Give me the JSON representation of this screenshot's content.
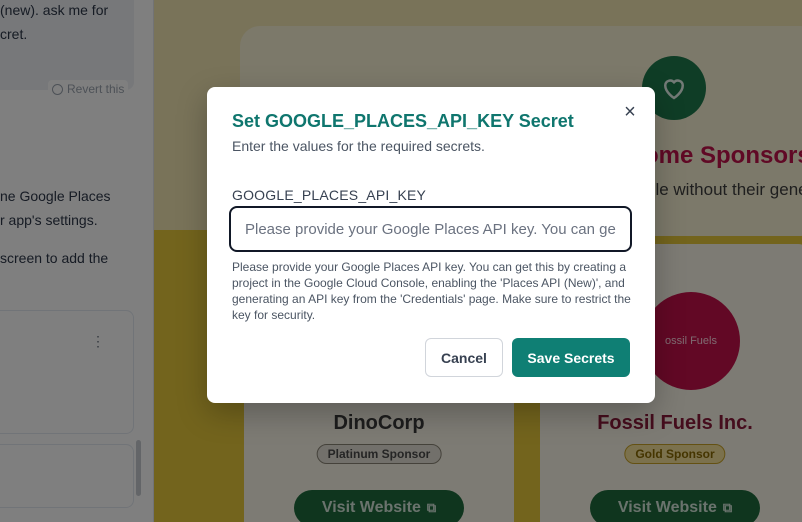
{
  "chat": {
    "bubble_lines": [
      "(new). ask me for",
      "cret."
    ],
    "revert_label": "Revert this",
    "message_lines": [
      "ne Google Places",
      "r app's settings.",
      "screen to add the"
    ]
  },
  "preview": {
    "section_title": "ome Sponsors",
    "section_subtitle": "ble without their gene",
    "sponsors": [
      {
        "name": "DinoCorp",
        "tier": "Platinum Sponsor",
        "logo_text": "",
        "button": "Visit Website"
      },
      {
        "name": "Fossil Fuels Inc.",
        "tier": "Gold Sponsor",
        "logo_text": "ossil Fuels",
        "button": "Visit Website"
      }
    ],
    "colors": {
      "accent_green": "#1f7a4d",
      "accent_red": "#c5104b",
      "background_yellow": "#e7c83a"
    }
  },
  "dialog": {
    "title": "Set GOOGLE_PLACES_API_KEY Secret",
    "description": "Enter the values for the required secrets.",
    "field_label": "GOOGLE_PLACES_API_KEY",
    "field_value": "",
    "field_placeholder": "Please provide your Google Places API key. You can get this by creating a project in the Google Cloud Console, enabling the 'Places API (New)', and generating an API key from the 'Credentials' page. Make sure to restrict the key for security.",
    "field_help": "Please provide your Google Places API key. You can get this by creating a project in the Google Cloud Console, enabling the 'Places API (New)', and generating an API key from the 'Credentials' page. Make sure to restrict the key for security.",
    "close_icon": "×",
    "cancel_label": "Cancel",
    "save_label": "Save Secrets",
    "colors": {
      "title": "#0f766e",
      "save_button": "#0f7f74"
    }
  }
}
